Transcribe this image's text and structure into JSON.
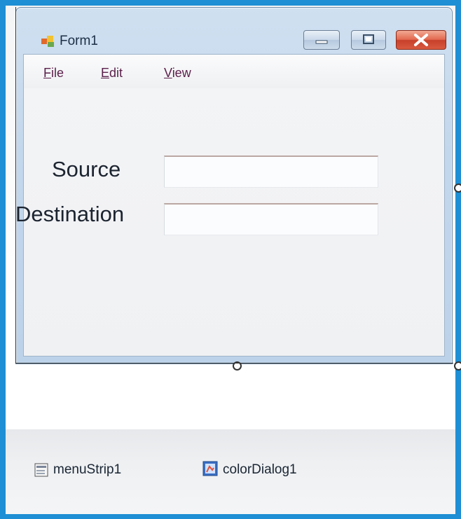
{
  "form": {
    "title": "Form1",
    "caption_buttons": {
      "minimize": "minimize-icon",
      "maximize": "maximize-icon",
      "close": "close-icon"
    }
  },
  "menu": [
    {
      "accel": "F",
      "rest": "ile"
    },
    {
      "accel": "E",
      "rest": "dit"
    },
    {
      "accel": "V",
      "rest": "iew"
    }
  ],
  "fields": {
    "source_label": "Source",
    "destination_label": "Destination",
    "source_value": "",
    "destination_value": ""
  },
  "tray": {
    "menu_strip": "menuStrip1",
    "color_dialog": "colorDialog1"
  },
  "colors": {
    "frame": "#1e8fd4",
    "close_button": "#d9593f",
    "menu_text": "#5a1f4a"
  }
}
